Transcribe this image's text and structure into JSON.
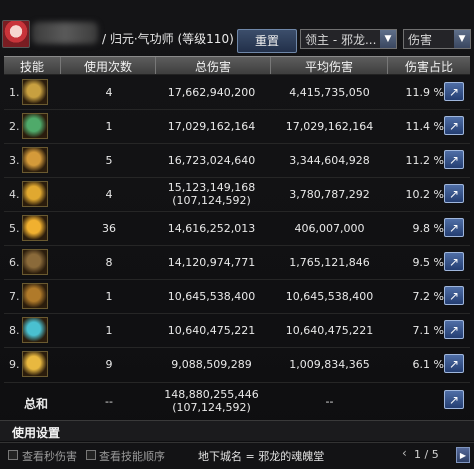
{
  "header": {
    "character_info": "/ 归元·气功师 (等级110)",
    "reset_label": "重置",
    "dungeon_select": "领主 - 邪龙...",
    "type_select": "伤害"
  },
  "columns": [
    "技能",
    "使用次数",
    "总伤害",
    "平均伤害",
    "伤害占比"
  ],
  "rows": [
    {
      "index": "1.",
      "uses": "4",
      "total": "17,662,940,200",
      "total_extra": "",
      "avg": "4,415,735,050",
      "pct": "11.9 %",
      "icon_color": "#c8a040"
    },
    {
      "index": "2.",
      "uses": "1",
      "total": "17,029,162,164",
      "total_extra": "",
      "avg": "17,029,162,164",
      "pct": "11.4 %",
      "icon_color": "#4faa6a"
    },
    {
      "index": "3.",
      "uses": "5",
      "total": "16,723,024,640",
      "total_extra": "",
      "avg": "3,344,604,928",
      "pct": "11.2 %",
      "icon_color": "#d49a3a"
    },
    {
      "index": "4.",
      "uses": "4",
      "total": "15,123,149,168",
      "total_extra": "(107,124,592)",
      "avg": "3,780,787,292",
      "pct": "10.2 %",
      "icon_color": "#e0a830"
    },
    {
      "index": "5.",
      "uses": "36",
      "total": "14,616,252,013",
      "total_extra": "",
      "avg": "406,007,000",
      "pct": "9.8 %",
      "icon_color": "#f0b030"
    },
    {
      "index": "6.",
      "uses": "8",
      "total": "14,120,974,771",
      "total_extra": "",
      "avg": "1,765,121,846",
      "pct": "9.5 %",
      "icon_color": "#8a6a3a"
    },
    {
      "index": "7.",
      "uses": "1",
      "total": "10,645,538,400",
      "total_extra": "",
      "avg": "10,645,538,400",
      "pct": "7.2 %",
      "icon_color": "#b07a2a"
    },
    {
      "index": "8.",
      "uses": "1",
      "total": "10,640,475,221",
      "total_extra": "",
      "avg": "10,640,475,221",
      "pct": "7.1 %",
      "icon_color": "#4ac0d0"
    },
    {
      "index": "9.",
      "uses": "9",
      "total": "9,088,509,289",
      "total_extra": "",
      "avg": "1,009,834,365",
      "pct": "6.1 %",
      "icon_color": "#e8b840"
    }
  ],
  "summary": {
    "label": "总和",
    "uses": "--",
    "total": "148,880,255,446",
    "total_extra": "(107,124,592)",
    "avg": "--"
  },
  "settings": {
    "title": "使用设置"
  },
  "footer": {
    "checkbox1": "查看秒伤害",
    "checkbox2": "查看技能顺序",
    "dungeon_name": "地下城名 = 邪龙的魂魄堂",
    "page_info": "1 / 5"
  },
  "icons": {
    "share": "share-icon",
    "dropdown": "chevron-down-icon",
    "prev": "chevron-left-icon",
    "next": "chevron-right-icon"
  }
}
